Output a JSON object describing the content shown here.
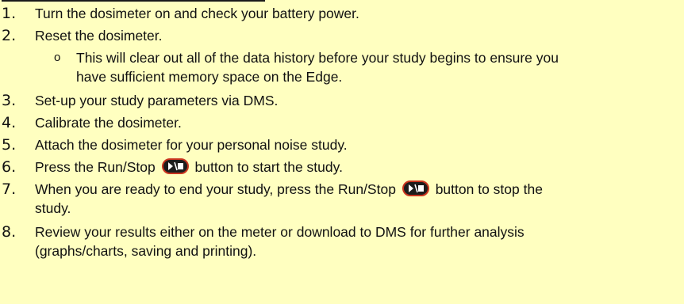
{
  "steps": [
    {
      "num": "1.",
      "text": "Turn the dosimeter on and check your battery power."
    },
    {
      "num": "2.",
      "text": "Reset the dosimeter."
    },
    {
      "num": "3.",
      "text": "Set-up your study parameters via DMS."
    },
    {
      "num": "4.",
      "text": "Calibrate the dosimeter."
    },
    {
      "num": "5.",
      "text": "Attach the dosimeter for your personal noise study."
    },
    {
      "num": "6.",
      "text_before": "Press the Run/Stop",
      "text_after": "button to start the study."
    },
    {
      "num": "7.",
      "text_before": "When you are ready to end your study, press the Run/Stop",
      "text_after": "button to stop the",
      "text_line2": "study."
    },
    {
      "num": "8.",
      "text_line1": "Review your results either on the meter or download to DMS for further analysis",
      "text_line2": "(graphs/charts, saving and printing)."
    }
  ],
  "sub_bullet": {
    "mark": "o",
    "line1": "This will clear out all of the data history before your study begins to ensure you",
    "line2": "have sufficient memory space on the Edge."
  },
  "icons": {
    "run_stop": "run-stop-button-icon"
  },
  "colors": {
    "background": "#ffffc0",
    "button_fill": "#1c1c1c",
    "button_ring": "#c8341e"
  }
}
